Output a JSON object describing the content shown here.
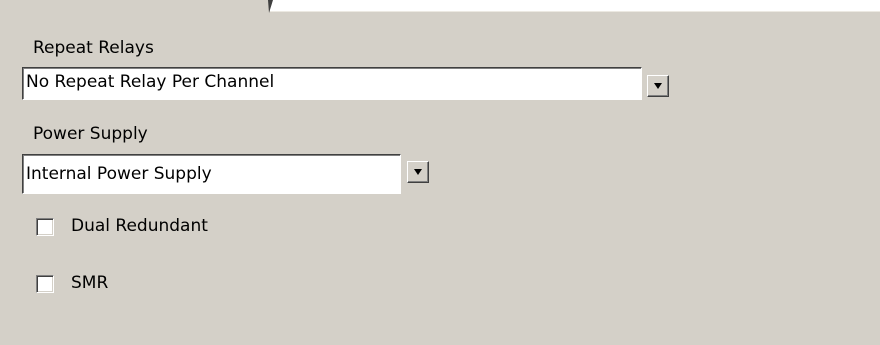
{
  "repeat_relays": {
    "label": "Repeat Relays",
    "selected": "No Repeat Relay Per Channel"
  },
  "power_supply": {
    "label": "Power Supply",
    "selected": "Internal Power Supply"
  },
  "options": {
    "dual_redundant": {
      "label": "Dual Redundant",
      "checked": false
    },
    "smr": {
      "label": "SMR",
      "checked": false
    }
  }
}
